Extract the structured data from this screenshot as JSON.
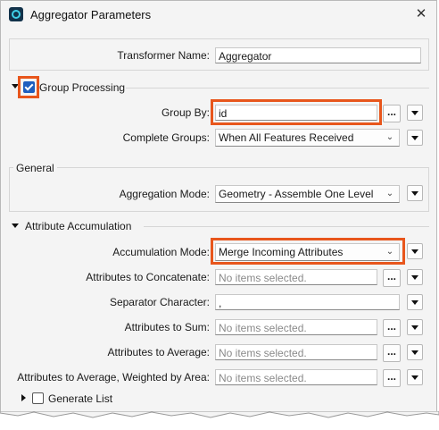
{
  "window": {
    "title": "Aggregator Parameters",
    "close_glyph": "✕"
  },
  "transformer_name": {
    "label": "Transformer Name:",
    "value": "Aggregator"
  },
  "group_processing": {
    "title": "Group Processing",
    "checked": true,
    "group_by": {
      "label": "Group By:",
      "value": "id",
      "ellipsis": "..."
    },
    "complete_groups": {
      "label": "Complete Groups:",
      "value": "When All Features Received"
    }
  },
  "general": {
    "title": "General",
    "aggregation_mode": {
      "label": "Aggregation Mode:",
      "value": "Geometry - Assemble One Level"
    }
  },
  "attribute_accumulation": {
    "title": "Attribute Accumulation",
    "accumulation_mode": {
      "label": "Accumulation Mode:",
      "value": "Merge Incoming Attributes"
    },
    "concatenate": {
      "label": "Attributes to Concatenate:",
      "placeholder": "No items selected."
    },
    "separator": {
      "label": "Separator Character:",
      "value": ","
    },
    "sum": {
      "label": "Attributes to Sum:",
      "placeholder": "No items selected."
    },
    "average": {
      "label": "Attributes to Average:",
      "placeholder": "No items selected."
    },
    "weighted": {
      "label": "Attributes to Average, Weighted by Area:",
      "placeholder": "No items selected."
    },
    "ellipsis": "..."
  },
  "generate_list": {
    "label": "Generate List",
    "checked": false
  },
  "colors": {
    "highlight": "#e8561c",
    "checkbox_checked": "#1f5fbf"
  },
  "icons": {
    "app": "fme-app-icon",
    "close": "close-icon",
    "expand": "triangle-down-icon",
    "collapse": "triangle-right-icon",
    "dropdown": "chevron-down-icon",
    "menu": "dropdown-menu-icon"
  }
}
